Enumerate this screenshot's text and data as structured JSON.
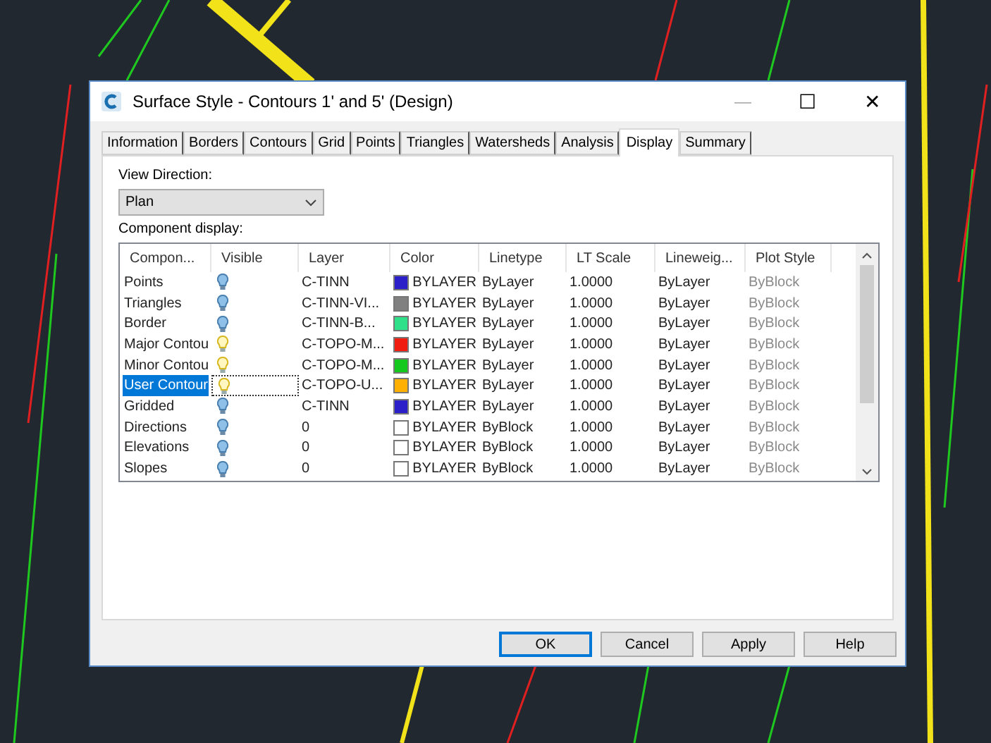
{
  "window": {
    "title": "Surface Style - Contours 1' and 5' (Design)",
    "controls": [
      "—",
      "☐",
      "✕"
    ]
  },
  "tabs": [
    {
      "label": "Information",
      "selected": false
    },
    {
      "label": "Borders",
      "selected": false
    },
    {
      "label": "Contours",
      "selected": false
    },
    {
      "label": "Grid",
      "selected": false
    },
    {
      "label": "Points",
      "selected": false
    },
    {
      "label": "Triangles",
      "selected": false
    },
    {
      "label": "Watersheds",
      "selected": false
    },
    {
      "label": "Analysis",
      "selected": false
    },
    {
      "label": "Display",
      "selected": true
    },
    {
      "label": "Summary",
      "selected": false
    }
  ],
  "view_direction": {
    "label": "View Direction:",
    "value": "Plan"
  },
  "component_display": {
    "label": "Component display:",
    "columns": [
      "Compon...",
      "Visible",
      "Layer",
      "Color",
      "Linetype",
      "LT Scale",
      "Lineweig...",
      "Plot Style"
    ],
    "rows": [
      {
        "component": "Points",
        "visible": false,
        "layer": "C-TINN",
        "color": "#2a1fc8",
        "color_name": "BYLAYER",
        "linetype": "ByLayer",
        "lt_scale": "1.0000",
        "lineweight": "ByLayer",
        "plot_style": "ByBlock",
        "selected": false
      },
      {
        "component": "Triangles",
        "visible": false,
        "layer": "C-TINN-VI...",
        "color": "#808080",
        "color_name": "BYLAYER",
        "linetype": "ByLayer",
        "lt_scale": "1.0000",
        "lineweight": "ByLayer",
        "plot_style": "ByBlock",
        "selected": false
      },
      {
        "component": "Border",
        "visible": false,
        "layer": "C-TINN-B...",
        "color": "#2ee08a",
        "color_name": "BYLAYER",
        "linetype": "ByLayer",
        "lt_scale": "1.0000",
        "lineweight": "ByLayer",
        "plot_style": "ByBlock",
        "selected": false
      },
      {
        "component": "Major Contou",
        "visible": true,
        "layer": "C-TOPO-M...",
        "color": "#f01c10",
        "color_name": "BYLAYER",
        "linetype": "ByLayer",
        "lt_scale": "1.0000",
        "lineweight": "ByLayer",
        "plot_style": "ByBlock",
        "selected": false
      },
      {
        "component": "Minor Contou",
        "visible": true,
        "layer": "C-TOPO-M...",
        "color": "#14c81e",
        "color_name": "BYLAYER",
        "linetype": "ByLayer",
        "lt_scale": "1.0000",
        "lineweight": "ByLayer",
        "plot_style": "ByBlock",
        "selected": false
      },
      {
        "component": "User Contour",
        "visible": true,
        "layer": "C-TOPO-U...",
        "color": "#ffb000",
        "color_name": "BYLAYER",
        "linetype": "ByLayer",
        "lt_scale": "1.0000",
        "lineweight": "ByLayer",
        "plot_style": "ByBlock",
        "selected": true
      },
      {
        "component": "Gridded",
        "visible": false,
        "layer": "C-TINN",
        "color": "#2a1fc8",
        "color_name": "BYLAYER",
        "linetype": "ByLayer",
        "lt_scale": "1.0000",
        "lineweight": "ByLayer",
        "plot_style": "ByBlock",
        "selected": false
      },
      {
        "component": "Directions",
        "visible": false,
        "layer": "0",
        "color": "#ffffff",
        "color_name": "BYLAYER",
        "linetype": "ByBlock",
        "lt_scale": "1.0000",
        "lineweight": "ByLayer",
        "plot_style": "ByBlock",
        "selected": false
      },
      {
        "component": "Elevations",
        "visible": false,
        "layer": "0",
        "color": "#ffffff",
        "color_name": "BYLAYER",
        "linetype": "ByBlock",
        "lt_scale": "1.0000",
        "lineweight": "ByLayer",
        "plot_style": "ByBlock",
        "selected": false
      },
      {
        "component": "Slopes",
        "visible": false,
        "layer": "0",
        "color": "#ffffff",
        "color_name": "BYLAYER",
        "linetype": "ByBlock",
        "lt_scale": "1.0000",
        "lineweight": "ByLayer",
        "plot_style": "ByBlock",
        "selected": false
      }
    ]
  },
  "buttons": [
    {
      "label": "OK",
      "default": true
    },
    {
      "label": "Cancel",
      "default": false
    },
    {
      "label": "Apply",
      "default": false
    },
    {
      "label": "Help",
      "default": false
    }
  ]
}
